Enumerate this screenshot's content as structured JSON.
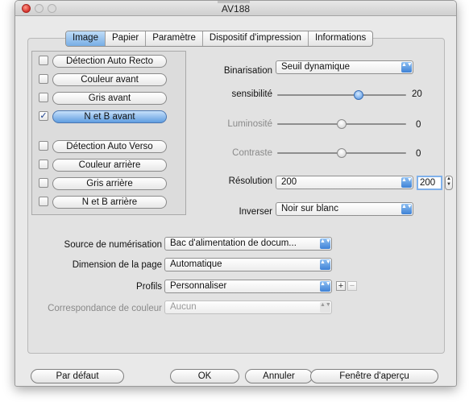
{
  "window": {
    "title": "AV188"
  },
  "tabs": [
    "Image",
    "Papier",
    "Paramètre",
    "Dispositif d'impression",
    "Informations"
  ],
  "modes": [
    {
      "label": "Détection Auto Recto",
      "checked": false
    },
    {
      "label": "Couleur avant",
      "checked": false
    },
    {
      "label": "Gris avant",
      "checked": false
    },
    {
      "label": "N et B avant",
      "checked": true
    },
    {
      "label": "Détection Auto Verso",
      "checked": false
    },
    {
      "label": "Couleur arrière",
      "checked": false
    },
    {
      "label": "Gris arrière",
      "checked": false
    },
    {
      "label": "N et B arrière",
      "checked": false
    }
  ],
  "checkmark": "✓",
  "binarisation": {
    "label": "Binarisation",
    "value": "Seuil dynamique"
  },
  "sensibilite": {
    "label": "sensibilité",
    "value": "20",
    "level": 0.63
  },
  "luminosite": {
    "label": "Luminosité",
    "value": "0",
    "level": 0.5
  },
  "contraste": {
    "label": "Contraste",
    "value": "0",
    "level": 0.5
  },
  "resolution": {
    "label": "Résolution",
    "value": "200",
    "field_value": "200"
  },
  "inverser": {
    "label": "Inverser",
    "value": "Noir sur blanc"
  },
  "source": {
    "label": "Source de numérisation",
    "value": "Bac d'alimentation de docum..."
  },
  "dimension": {
    "label": "Dimension de la page",
    "value": "Automatique"
  },
  "profils": {
    "label": "Profils",
    "value": "Personnaliser",
    "add": "+",
    "remove": "−"
  },
  "correspondance": {
    "label": "Correspondance de couleur",
    "value": "Aucun"
  },
  "buttons": {
    "default": "Par défaut",
    "ok": "OK",
    "cancel": "Annuler",
    "preview": "Fenêtre d'aperçu"
  },
  "icons": {
    "popup_arrows": "▲▼",
    "stepper_up": "▲",
    "stepper_down": "▼"
  },
  "colors": {
    "accent": "#3e82d6",
    "selected": "#5f9de0",
    "close": "#d5302a"
  }
}
